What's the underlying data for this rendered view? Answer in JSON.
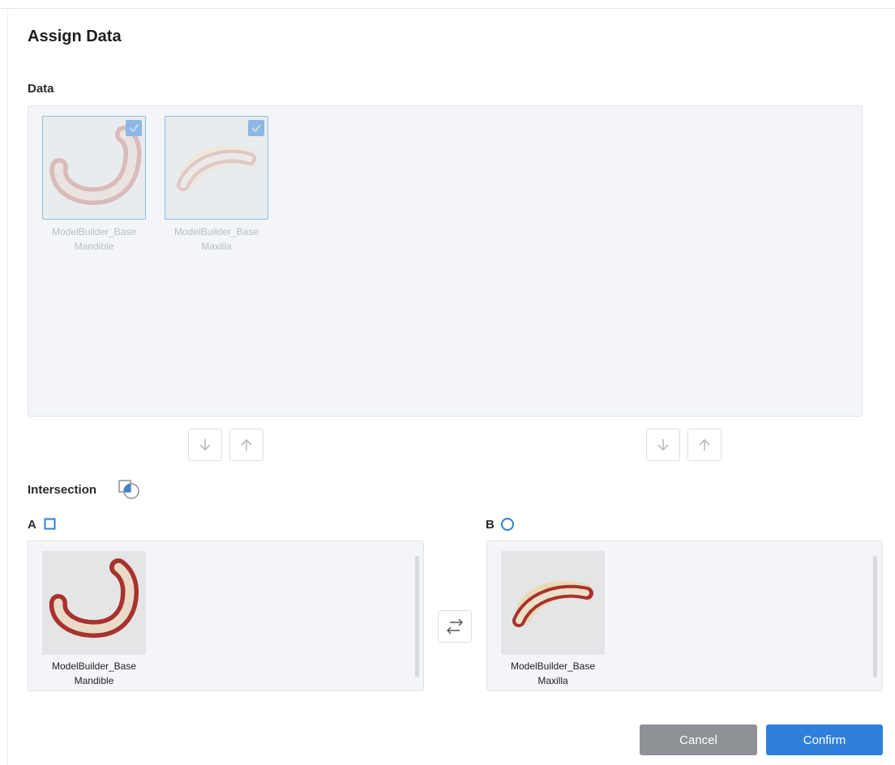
{
  "dialog": {
    "title": "Assign Data"
  },
  "data_section": {
    "label": "Data",
    "items": [
      {
        "line1": "ModelBuilder_Base",
        "line2": "Mandible",
        "checked": true,
        "icon": "mandible-model-thumbnail"
      },
      {
        "line1": "ModelBuilder_Base",
        "line2": "Maxilla",
        "checked": true,
        "icon": "maxilla-model-thumbnail"
      }
    ]
  },
  "intersection": {
    "label": "Intersection"
  },
  "slot_a": {
    "label": "A",
    "shape": "square",
    "item": {
      "line1": "ModelBuilder_Base",
      "line2": "Mandible"
    }
  },
  "slot_b": {
    "label": "B",
    "shape": "circle",
    "item": {
      "line1": "ModelBuilder_Base",
      "line2": "Maxilla"
    }
  },
  "buttons": {
    "cancel": "Cancel",
    "confirm": "Confirm"
  },
  "colors": {
    "accent": "#2f80d8",
    "cancel": "#8e9297",
    "selection": "#8cb8e3",
    "panel": "#f3f5f8"
  }
}
